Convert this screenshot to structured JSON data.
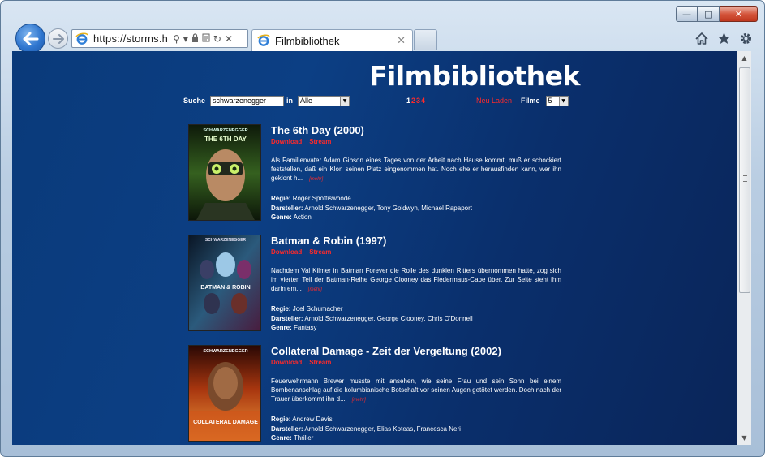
{
  "browser": {
    "address_text": "https://storms.h",
    "tab_title": "Filmbibliothek"
  },
  "page": {
    "title": "Filmbibliothek",
    "filter": {
      "search_label": "Suche",
      "search_value": "schwarzenegger",
      "in_label": "in",
      "in_selected": "Alle",
      "pages": {
        "current": "1",
        "others": [
          "2",
          "3",
          "4"
        ]
      },
      "reload_label": "Neu Laden",
      "films_label": "Filme",
      "films_selected": "5"
    },
    "movies": [
      {
        "title": "The 6th Day (2000)",
        "download": "Download",
        "stream": "Stream",
        "description": "Als Familienvater Adam Gibson eines Tages von der Arbeit nach Hause kommt, muß er schockiert feststellen, daß ein Klon seinen Platz eingenommen hat. Noch ehe er herausfinden kann, wer ihn geklont h...",
        "more": "[mehr]",
        "director_label": "Regie:",
        "director": "Roger Spottiswoode",
        "cast_label": "Darsteller:",
        "cast": "Arnold Schwarzenegger, Tony Goldwyn, Michael Rapaport",
        "genre_label": "Genre:",
        "genre": "Action",
        "poster": {
          "top_text": "SCHWARZENEGGER",
          "title_text": "THE 6TH DAY",
          "colors": [
            "#1a2a10",
            "#3a6e22",
            "#9fdc4a"
          ]
        }
      },
      {
        "title": "Batman & Robin (1997)",
        "download": "Download",
        "stream": "Stream",
        "description": "Nachdem Val Kilmer in Batman Forever die Rolle des dunklen Ritters übernommen hatte, zog sich im vierten Teil der Batman-Reihe George Clooney das Fledermaus-Cape über. Zur Seite steht ihm darin em...",
        "more": "[mehr]",
        "director_label": "Regie:",
        "director": "Joel Schumacher",
        "cast_label": "Darsteller:",
        "cast": "Arnold Schwarzenegger, George Clooney, Chris O'Donnell",
        "genre_label": "Genre:",
        "genre": "Fantasy",
        "poster": {
          "top_text": "SCHWARZENEGGER",
          "title_text": "BATMAN & ROBIN",
          "colors": [
            "#0c1b2e",
            "#2f5a7a",
            "#a23a7a"
          ]
        }
      },
      {
        "title": "Collateral Damage - Zeit der Vergeltung (2002)",
        "download": "Download",
        "stream": "Stream",
        "description": "Feuerwehrmann Brewer musste mit ansehen, wie seine Frau und sein Sohn bei einem Bombenanschlag auf die kolumbianische Botschaft vor seinen Augen getötet werden. Doch nach der Trauer überkommt ihn d...",
        "more": "[mehr]",
        "director_label": "Regie:",
        "director": "Andrew Davis",
        "cast_label": "Darsteller:",
        "cast": "Arnold Schwarzenegger, Elias Koteas, Francesca Neri",
        "genre_label": "Genre:",
        "genre": "Thriller",
        "poster": {
          "top_text": "SCHWARZENEGGER",
          "title_text": "COLLATERAL DAMAGE",
          "colors": [
            "#3a0c06",
            "#b23a12",
            "#f0a040"
          ]
        }
      }
    ]
  }
}
